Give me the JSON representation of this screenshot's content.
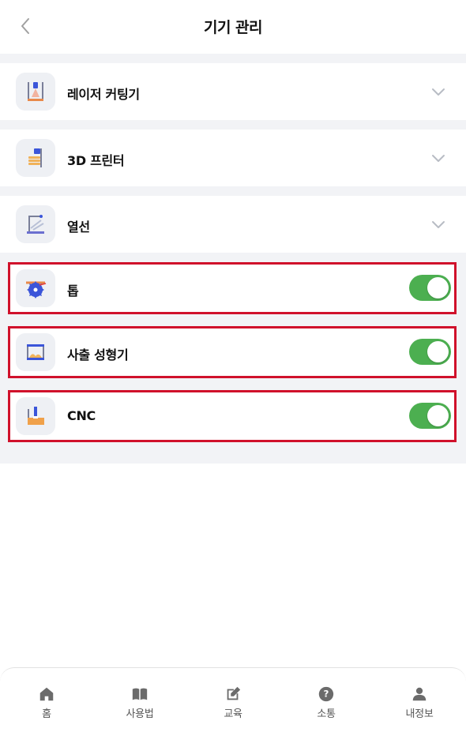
{
  "header": {
    "title": "기기 관리"
  },
  "devices": [
    {
      "label": "레이저 커팅기",
      "icon": "laser-cutter-icon",
      "control": "chevron"
    },
    {
      "label": "3D 프린터",
      "icon": "3d-printer-icon",
      "control": "chevron"
    },
    {
      "label": "열선",
      "icon": "hot-wire-icon",
      "control": "chevron"
    },
    {
      "label": "톱",
      "icon": "saw-icon",
      "control": "toggle",
      "on": true
    },
    {
      "label": "사출 성형기",
      "icon": "injection-molder-icon",
      "control": "toggle",
      "on": true
    },
    {
      "label": "CNC",
      "icon": "cnc-icon",
      "control": "toggle",
      "on": true
    }
  ],
  "colors": {
    "toggle_on": "#4caf50",
    "highlight": "#d0112b",
    "divider_bg": "#f2f3f6"
  },
  "tabs": [
    {
      "label": "홈",
      "icon": "home-icon"
    },
    {
      "label": "사용법",
      "icon": "book-icon"
    },
    {
      "label": "교육",
      "icon": "edit-icon"
    },
    {
      "label": "소통",
      "icon": "question-icon"
    },
    {
      "label": "내정보",
      "icon": "user-icon"
    }
  ]
}
